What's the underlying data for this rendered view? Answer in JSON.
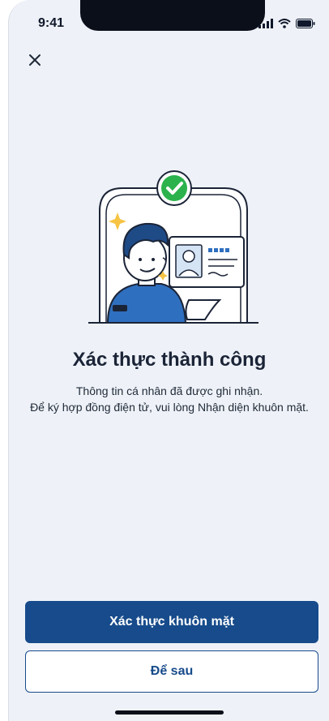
{
  "status_bar": {
    "time": "9:41",
    "icons": [
      "signal-icon",
      "wifi-icon",
      "battery-icon"
    ]
  },
  "header": {
    "close_icon": "close-icon"
  },
  "illustration": {
    "name": "success-illustration",
    "check_icon": "check-badge-icon"
  },
  "content": {
    "title": "Xác thực thành công",
    "line1": "Thông tin cá nhân đã được ghi nhận.",
    "line2": "Để ký hợp đồng điện tử, vui lòng Nhận diện khuôn mặt."
  },
  "actions": {
    "primary_label": "Xác thực khuôn mặt",
    "secondary_label": "Để sau"
  },
  "colors": {
    "primary": "#174b8b",
    "background": "#eef2f8",
    "success": "#2bb24c",
    "accent_yellow": "#f6c343"
  }
}
